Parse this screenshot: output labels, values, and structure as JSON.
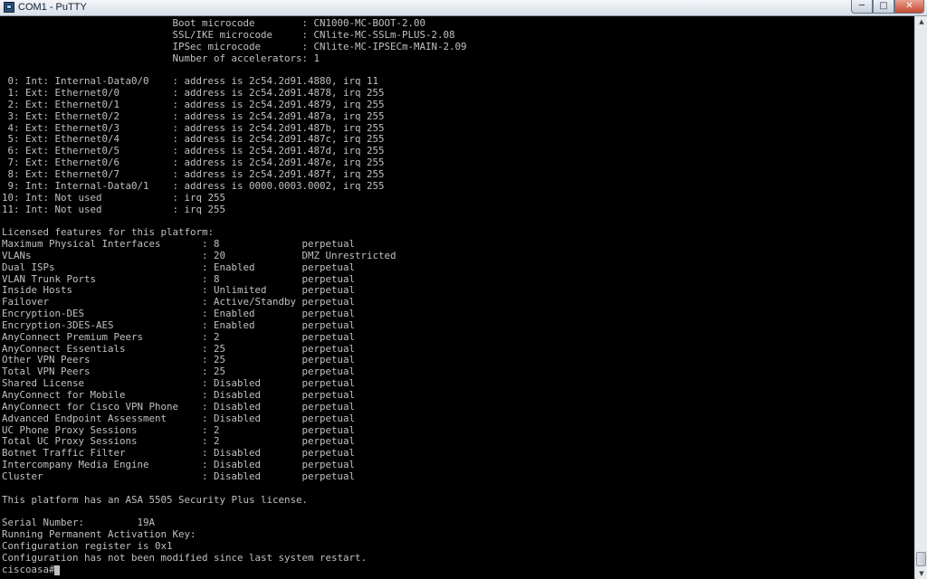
{
  "window": {
    "title": "COM1 - PuTTY",
    "icon": "putty-icon",
    "controls": {
      "minimize_glyph": "─",
      "maximize_glyph": "□",
      "close_glyph": "✕"
    }
  },
  "scrollbar": {
    "up_glyph": "▲",
    "down_glyph": "▼"
  },
  "terminal": {
    "lines": [
      "                             Boot microcode        : CN1000-MC-BOOT-2.00",
      "                             SSL/IKE microcode     : CNlite-MC-SSLm-PLUS-2.08",
      "                             IPSec microcode       : CNlite-MC-IPSECm-MAIN-2.09",
      "                             Number of accelerators: 1",
      "",
      " 0: Int: Internal-Data0/0    : address is 2c54.2d91.4880, irq 11",
      " 1: Ext: Ethernet0/0         : address is 2c54.2d91.4878, irq 255",
      " 2: Ext: Ethernet0/1         : address is 2c54.2d91.4879, irq 255",
      " 3: Ext: Ethernet0/2         : address is 2c54.2d91.487a, irq 255",
      " 4: Ext: Ethernet0/3         : address is 2c54.2d91.487b, irq 255",
      " 5: Ext: Ethernet0/4         : address is 2c54.2d91.487c, irq 255",
      " 6: Ext: Ethernet0/5         : address is 2c54.2d91.487d, irq 255",
      " 7: Ext: Ethernet0/6         : address is 2c54.2d91.487e, irq 255",
      " 8: Ext: Ethernet0/7         : address is 2c54.2d91.487f, irq 255",
      " 9: Int: Internal-Data0/1    : address is 0000.0003.0002, irq 255",
      "10: Int: Not used            : irq 255",
      "11: Int: Not used            : irq 255",
      "",
      "Licensed features for this platform:",
      "Maximum Physical Interfaces       : 8              perpetual",
      "VLANs                             : 20             DMZ Unrestricted",
      "Dual ISPs                         : Enabled        perpetual",
      "VLAN Trunk Ports                  : 8              perpetual",
      "Inside Hosts                      : Unlimited      perpetual",
      "Failover                          : Active/Standby perpetual",
      "Encryption-DES                    : Enabled        perpetual",
      "Encryption-3DES-AES               : Enabled        perpetual",
      "AnyConnect Premium Peers          : 2              perpetual",
      "AnyConnect Essentials             : 25             perpetual",
      "Other VPN Peers                   : 25             perpetual",
      "Total VPN Peers                   : 25             perpetual",
      "Shared License                    : Disabled       perpetual",
      "AnyConnect for Mobile             : Disabled       perpetual",
      "AnyConnect for Cisco VPN Phone    : Disabled       perpetual",
      "Advanced Endpoint Assessment      : Disabled       perpetual",
      "UC Phone Proxy Sessions           : 2              perpetual",
      "Total UC Proxy Sessions           : 2              perpetual",
      "Botnet Traffic Filter             : Disabled       perpetual",
      "Intercompany Media Engine         : Disabled       perpetual",
      "Cluster                           : Disabled       perpetual",
      "",
      "This platform has an ASA 5505 Security Plus license.",
      "",
      "Serial Number:         19A",
      "Running Permanent Activation Key:",
      "Configuration register is 0x1",
      "Configuration has not been modified since last system restart.",
      "ciscoasa#"
    ]
  },
  "colors": {
    "terminal_background": "#000000",
    "terminal_foreground": "#c0c0c0",
    "close_button": "#c44a33"
  }
}
